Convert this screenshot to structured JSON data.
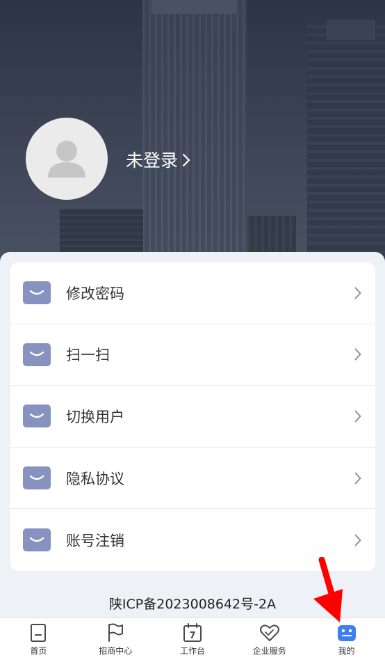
{
  "profile": {
    "login_text": "未登录"
  },
  "menu": {
    "items": [
      {
        "label": "修改密码",
        "icon": "chevron-down-icon"
      },
      {
        "label": "扫一扫",
        "icon": "chevron-down-icon"
      },
      {
        "label": "切换用户",
        "icon": "chevron-down-icon"
      },
      {
        "label": "隐私协议",
        "icon": "chevron-down-icon"
      },
      {
        "label": "账号注销",
        "icon": "chevron-down-icon"
      }
    ]
  },
  "footer": {
    "icp": "陕ICP备2023008642号-2A"
  },
  "tabbar": {
    "tabs": [
      {
        "label": "首页",
        "icon": "home-icon"
      },
      {
        "label": "招商中心",
        "icon": "flag-icon"
      },
      {
        "label": "工作台",
        "icon": "calendar-icon",
        "badge": "7"
      },
      {
        "label": "企业服务",
        "icon": "heart-handshake-icon"
      },
      {
        "label": "我的",
        "icon": "profile-face-icon",
        "active": true
      }
    ]
  },
  "colors": {
    "accent": "#3d7ef0",
    "menu_icon_bg": "#8892c0",
    "annotation_arrow": "#ff0000"
  }
}
